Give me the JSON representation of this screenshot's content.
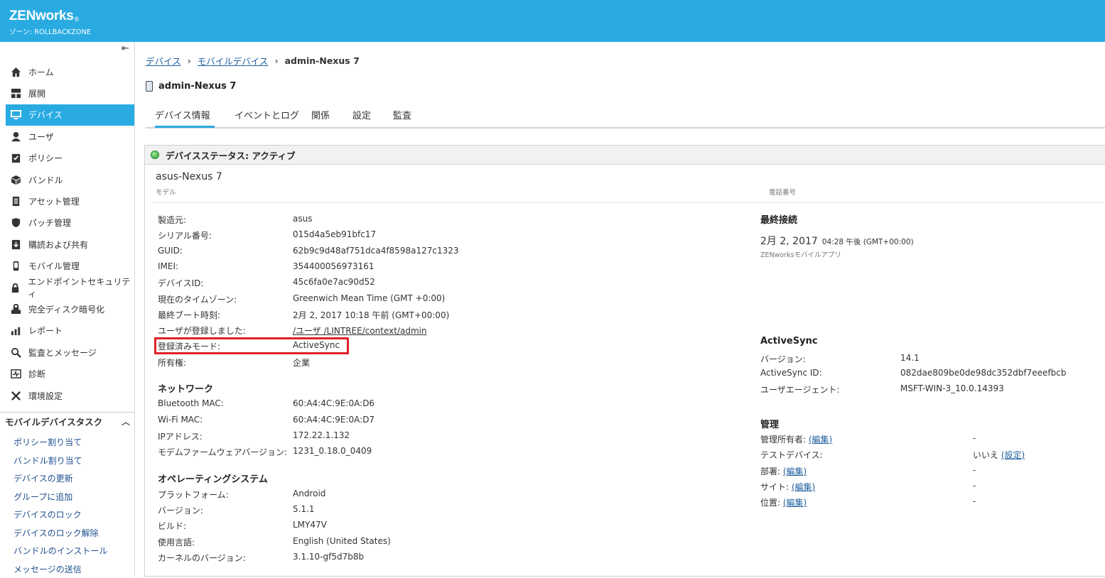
{
  "header": {
    "brand": "ZENworks",
    "reg": "®",
    "zone": "ゾーン: ROLLBACKZONE"
  },
  "sidebar": {
    "items": [
      {
        "label": "ホーム",
        "icon": "home-icon"
      },
      {
        "label": "展開",
        "icon": "deploy-icon"
      },
      {
        "label": "デバイス",
        "icon": "monitor-icon",
        "active": true
      },
      {
        "label": "ユーザ",
        "icon": "user-icon"
      },
      {
        "label": "ポリシー",
        "icon": "policy-icon"
      },
      {
        "label": "バンドル",
        "icon": "bundle-icon"
      },
      {
        "label": "アセット管理",
        "icon": "asset-icon"
      },
      {
        "label": "パッチ管理",
        "icon": "shield-icon"
      },
      {
        "label": "購読および共有",
        "icon": "download-icon"
      },
      {
        "label": "モバイル管理",
        "icon": "mobile-icon"
      },
      {
        "label": "エンドポイントセキュリティ",
        "icon": "lock-icon"
      },
      {
        "label": "完全ディスク暗号化",
        "icon": "disk-lock-icon"
      },
      {
        "label": "レポート",
        "icon": "chart-icon"
      },
      {
        "label": "監査とメッセージ",
        "icon": "search-icon"
      },
      {
        "label": "診断",
        "icon": "diagnostics-icon"
      },
      {
        "label": "環境設定",
        "icon": "tools-icon"
      }
    ],
    "tasks_title": "モバイルデバイスタスク",
    "tasks": [
      "ポリシー割り当て",
      "バンドル割り当て",
      "デバイスの更新",
      "グループに追加",
      "デバイスのロック",
      "デバイスのロック解除",
      "バンドルのインストール",
      "メッセージの送信"
    ]
  },
  "breadcrumb": {
    "c1": "デバイス",
    "c2": "モバイルデバイス",
    "c3": "admin-Nexus 7"
  },
  "page_title": "admin-Nexus 7",
  "tabs": [
    "デバイス情報",
    "イベントとログ",
    "関係",
    "設定",
    "監査"
  ],
  "panel": {
    "status": "デバイスステータス: アクティブ",
    "model": "asus-Nexus 7",
    "model_label": "モデル",
    "phone_label": "電話番号",
    "details": [
      {
        "label": "製造元:",
        "value": "asus"
      },
      {
        "label": "シリアル番号:",
        "value": "015d4a5eb91bfc17"
      },
      {
        "label": "GUID:",
        "value": "62b9c9d48af751dca4f8598a127c1323"
      },
      {
        "label": "IMEI:",
        "value": "354400056973161"
      },
      {
        "label": "デバイスID:",
        "value": "45c6fa0e7ac90d52"
      },
      {
        "label": "現在のタイムゾーン:",
        "value": "Greenwich Mean Time (GMT +0:00)"
      },
      {
        "label": "最終ブート時刻:",
        "value": "2月 2, 2017 10:18 午前 (GMT+00:00)"
      },
      {
        "label": "ユーザが登録しました:",
        "value": "/ユーザ /LINTREE/context/admin"
      },
      {
        "label": "登録済みモード:",
        "value": "ActiveSync"
      },
      {
        "label": "所有権:",
        "value": "企業"
      }
    ],
    "network_title": "ネットワーク",
    "network": [
      {
        "label": "Bluetooth MAC:",
        "value": "60:A4:4C:9E:0A:D6"
      },
      {
        "label": "Wi-Fi MAC:",
        "value": "60:A4:4C:9E:0A:D7"
      },
      {
        "label": "IPアドレス:",
        "value": "172.22.1.132"
      },
      {
        "label": "モデムファームウェアバージョン:",
        "value": "1231_0.18.0_0409"
      }
    ],
    "os_title": "オペレーティングシステム",
    "os": [
      {
        "label": "プラットフォーム:",
        "value": "Android"
      },
      {
        "label": "バージョン:",
        "value": "5.1.1"
      },
      {
        "label": "ビルド:",
        "value": "LMY47V"
      },
      {
        "label": "使用言語:",
        "value": "English (United States)"
      },
      {
        "label": "カーネルのバージョン:",
        "value": "3.1.10-gf5d7b8b"
      }
    ],
    "last_contact_title": "最終接続",
    "last_contact_date": "2月 2, 2017",
    "last_contact_time": "04:28 午後 (GMT+00:00)",
    "last_contact_src": "ZENworksモバイルアプリ",
    "activesync_title": "ActiveSync",
    "activesync": [
      {
        "label": "バージョン:",
        "value": "14.1"
      },
      {
        "label": "ActiveSync ID:",
        "value": "082dae809be0de98dc352dbf7eeefbcb"
      },
      {
        "label": "ユーザエージェント:",
        "value": "MSFT-WIN-3_10.0.14393"
      }
    ],
    "admin_title": "管理",
    "admin": [
      {
        "label": "管理所有者:",
        "link": "(編集)",
        "value": "-"
      },
      {
        "label": "テストデバイス:",
        "value": "いいえ",
        "link": "(設定)"
      },
      {
        "label": "部署:",
        "link": "(編集)",
        "value": "-"
      },
      {
        "label": "サイト:",
        "link": "(編集)",
        "value": "-"
      },
      {
        "label": "位置:",
        "link": "(編集)",
        "value": "-"
      }
    ]
  }
}
